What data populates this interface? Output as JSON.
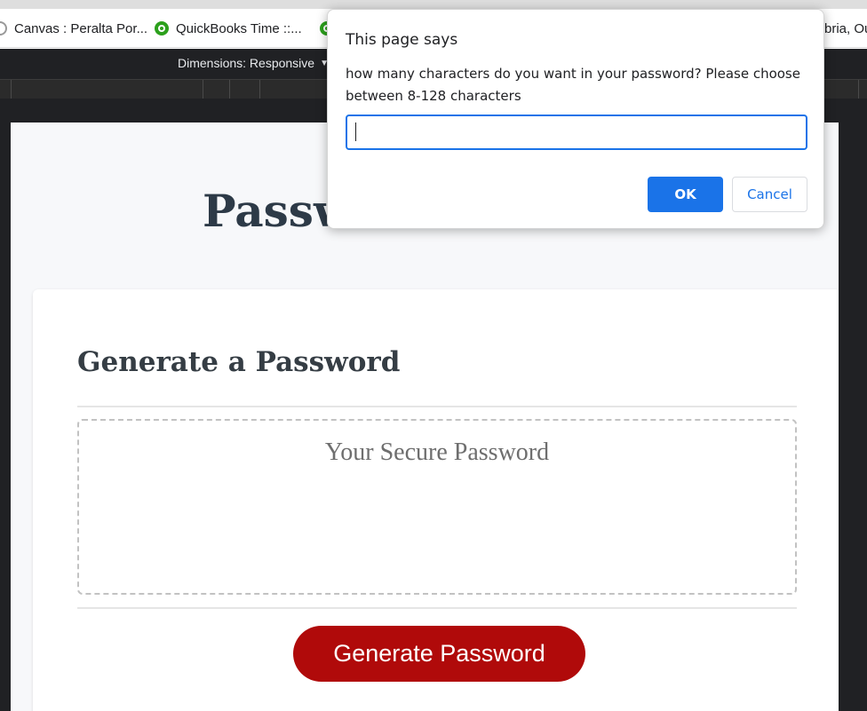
{
  "bookmarks_bar": {
    "items": [
      {
        "label": "Canvas : Peralta Por...",
        "icon": "canvas-icon"
      },
      {
        "label": "QuickBooks Time ::...",
        "icon": "quickbooks-icon"
      },
      {
        "label": "",
        "icon": "quickbooks-icon"
      },
      {
        "label": "bria, Ou",
        "icon": ""
      }
    ]
  },
  "devtools": {
    "dimensions_label": "Dimensions: Responsive"
  },
  "page": {
    "title_visible": "Passw",
    "card": {
      "heading": "Generate a Password",
      "password_placeholder": "Your Secure Password",
      "generate_button": "Generate Password"
    }
  },
  "dialog": {
    "title": "This page says",
    "message": "how many characters do you want in your password? Please choose between 8-128 characters",
    "input_value": "",
    "ok_label": "OK",
    "cancel_label": "Cancel"
  },
  "colors": {
    "button_red": "#b00a0a",
    "dialog_blue": "#1a73e8",
    "heading_dark": "#353d44",
    "devtools_dark": "#202124"
  }
}
